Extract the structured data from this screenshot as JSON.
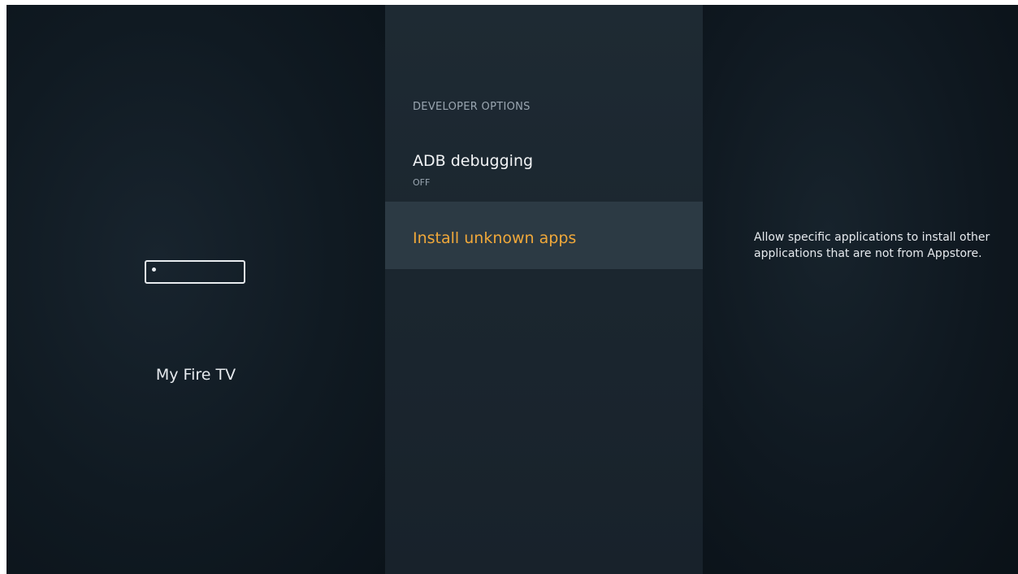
{
  "left_panel": {
    "device_icon": "fire-tv-device-icon",
    "device_name": "My Fire TV"
  },
  "menu": {
    "section_title": "DEVELOPER OPTIONS",
    "items": [
      {
        "label": "ADB debugging",
        "value": "OFF",
        "selected": false
      },
      {
        "label": "Install unknown apps",
        "selected": true
      }
    ]
  },
  "info_panel": {
    "description": "Allow specific applications to install other applications that are not from Appstore."
  },
  "colors": {
    "highlight_text": "#f0a83a",
    "selected_row_bg": "#2c3a44",
    "middle_panel_bg": "#1e2a33",
    "background": "#0f1820"
  }
}
